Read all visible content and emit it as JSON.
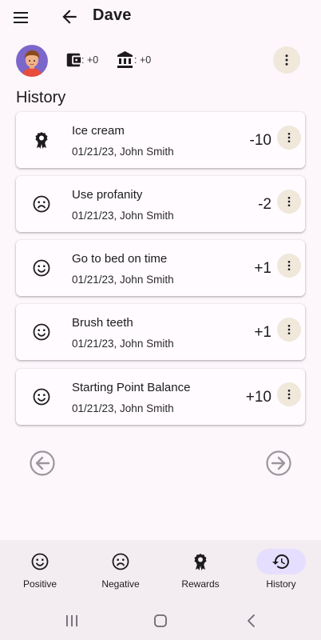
{
  "header": {
    "title": "Dave"
  },
  "summary": {
    "wallet_value": ": +0",
    "bank_value": ": +0"
  },
  "section_title": "History",
  "history": [
    {
      "name": "Ice cream",
      "meta": "01/21/23, John Smith",
      "points": "-10",
      "icon": "reward-ribbon-icon"
    },
    {
      "name": "Use profanity",
      "meta": "01/21/23, John Smith",
      "points": "-2",
      "icon": "sad-face-icon"
    },
    {
      "name": "Go to bed on time",
      "meta": "01/21/23, John Smith",
      "points": "+1",
      "icon": "smile-face-icon"
    },
    {
      "name": "Brush teeth",
      "meta": "01/21/23, John Smith",
      "points": "+1",
      "icon": "smile-face-icon"
    },
    {
      "name": "Starting Point Balance",
      "meta": "01/21/23, John Smith",
      "points": "+10",
      "icon": "smile-face-icon"
    }
  ],
  "nav": [
    {
      "label": "Positive",
      "icon": "smile-face-icon"
    },
    {
      "label": "Negative",
      "icon": "sad-face-icon"
    },
    {
      "label": "Rewards",
      "icon": "reward-ribbon-icon"
    },
    {
      "label": "History",
      "icon": "history-icon",
      "active": true
    }
  ],
  "colors": {
    "accent_pill": "#e6deff",
    "more_button_bg": "#efe8db",
    "background": "#fdf7fc"
  }
}
